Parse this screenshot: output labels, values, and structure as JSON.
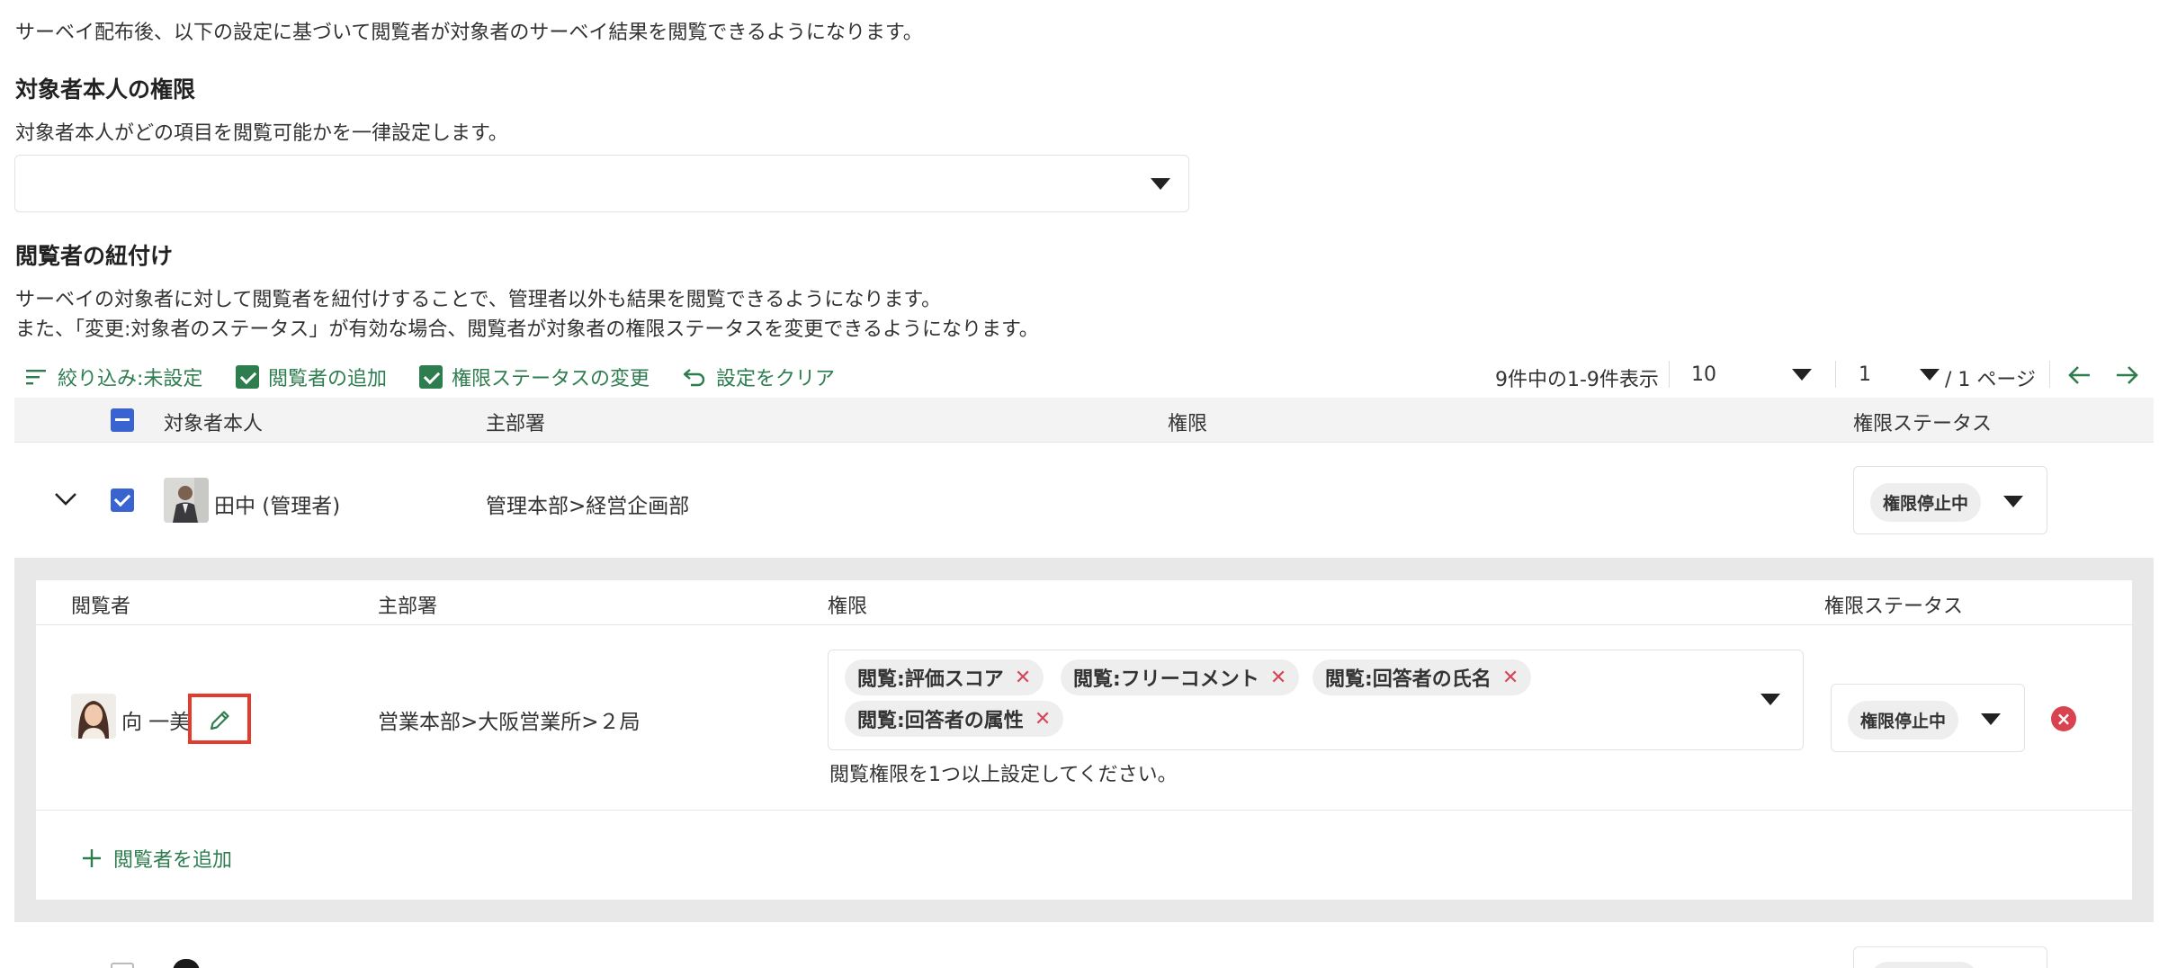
{
  "intro": "サーベイ配布後、以下の設定に基づいて閲覧者が対象者のサーベイ結果を閲覧できるようになります。",
  "self_permission": {
    "heading": "対象者本人の権限",
    "description": "対象者本人がどの項目を閲覧可能かを一律設定します。",
    "select_value": ""
  },
  "viewer_link": {
    "heading": "閲覧者の紐付け",
    "description_1": "サーベイの対象者に対して閲覧者を紐付けすることで、管理者以外も結果を閲覧できるようになります。",
    "description_2": "また、「変更:対象者のステータス」が有効な場合、閲覧者が対象者の権限ステータスを変更できるようになります。"
  },
  "toolbar": {
    "filter_label": "絞り込み:未設定",
    "add_viewer_label": "閲覧者の追加",
    "change_status_label": "権限ステータスの変更",
    "clear_label": "設定をクリア"
  },
  "pagination": {
    "summary": "9件中の1-9件表示",
    "page_size": "10",
    "page": "1",
    "page_total": "/ 1 ページ"
  },
  "table": {
    "columns": [
      "対象者本人",
      "主部署",
      "権限",
      "権限ステータス"
    ],
    "rows": [
      {
        "name": "田中 (管理者)",
        "department": "管理本部>経営企画部",
        "permission": "",
        "status": "権限停止中",
        "checked": true,
        "expanded": true
      }
    ]
  },
  "viewers": {
    "columns": [
      "閲覧者",
      "主部署",
      "権限",
      "権限ステータス"
    ],
    "rows": [
      {
        "name": "向 一美",
        "department": "営業本部>大阪営業所>２局",
        "tags": [
          "閲覧:評価スコア",
          "閲覧:フリーコメント",
          "閲覧:回答者の氏名",
          "閲覧:回答者の属性"
        ],
        "hint": "閲覧権限を1つ以上設定してください。",
        "status": "権限停止中"
      }
    ],
    "add_label": "閲覧者を追加"
  },
  "colors": {
    "accent_green": "#2e7d4f",
    "checkbox_blue": "#3a63d2",
    "highlight_red": "#e33b2e",
    "delete_red": "#d9424f"
  }
}
